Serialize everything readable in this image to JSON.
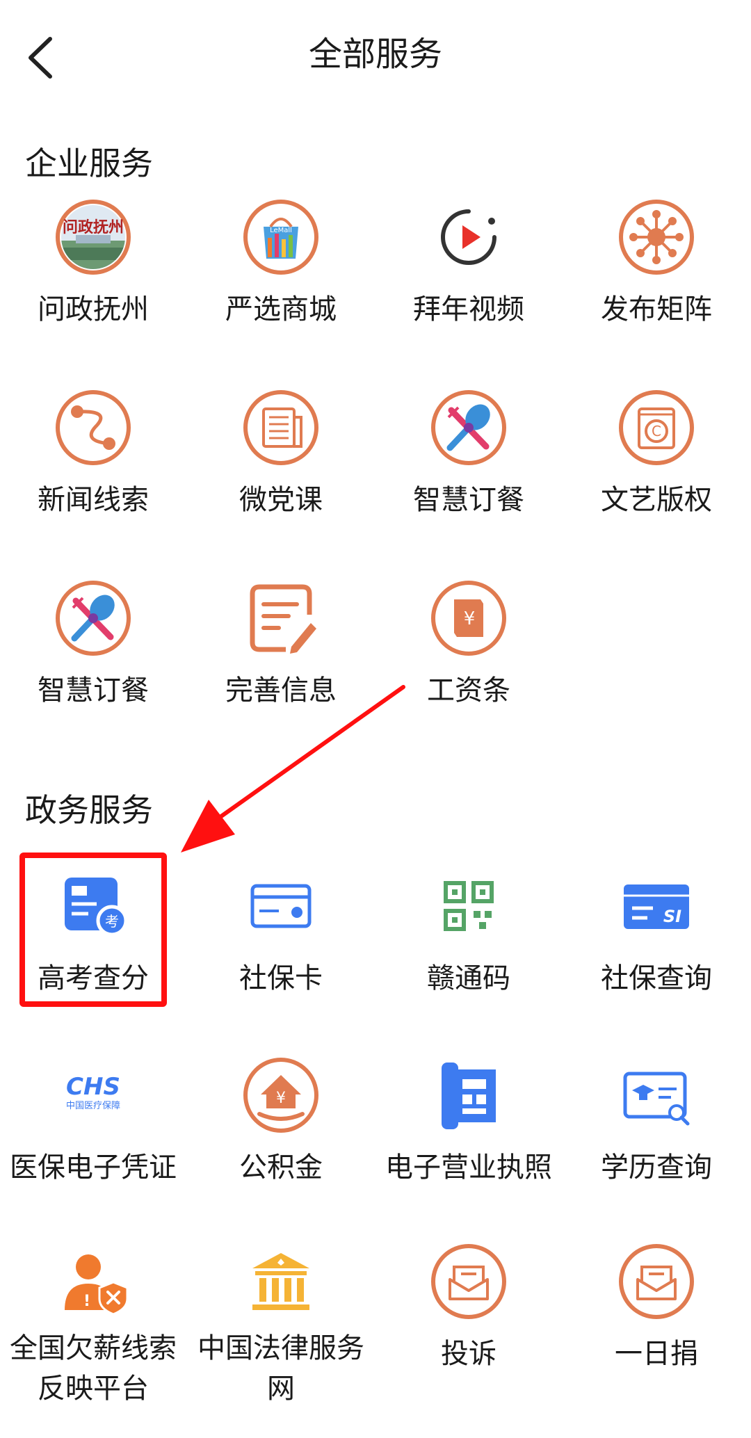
{
  "header": {
    "title": "全部服务"
  },
  "sections": [
    {
      "title": "企业服务",
      "items": [
        {
          "label": "问政抚州",
          "icon": "wenzheng-fuzhou-photo-icon"
        },
        {
          "label": "严选商城",
          "icon": "lemall-shopping-icon"
        },
        {
          "label": "拜年视频",
          "icon": "play-video-icon"
        },
        {
          "label": "发布矩阵",
          "icon": "network-hub-icon"
        },
        {
          "label": "新闻线索",
          "icon": "route-path-icon"
        },
        {
          "label": "微党课",
          "icon": "newspaper-icon"
        },
        {
          "label": "智慧订餐",
          "icon": "spoon-fork-icon"
        },
        {
          "label": "文艺版权",
          "icon": "copyright-book-icon"
        },
        {
          "label": "智慧订餐",
          "icon": "spoon-fork-icon"
        },
        {
          "label": "完善信息",
          "icon": "edit-form-icon"
        },
        {
          "label": "工资条",
          "icon": "yuan-receipt-icon"
        }
      ]
    },
    {
      "title": "政务服务",
      "items": [
        {
          "label": "高考查分",
          "icon": "exam-score-icon",
          "badge": "考"
        },
        {
          "label": "社保卡",
          "icon": "social-security-card-icon"
        },
        {
          "label": "赣通码",
          "icon": "qr-code-icon"
        },
        {
          "label": "社保查询",
          "icon": "si-card-icon",
          "badge": "SI"
        },
        {
          "label": "医保电子凭证",
          "icon": "chs-medical-insurance-icon",
          "badge": "CHS",
          "badge_sub": "中国医疗保障"
        },
        {
          "label": "公积金",
          "icon": "housing-fund-icon"
        },
        {
          "label": "电子营业执照",
          "icon": "business-license-icon"
        },
        {
          "label": "学历查询",
          "icon": "education-certificate-icon"
        },
        {
          "label": "全国欠薪线索反映平台",
          "icon": "wage-arrears-report-icon"
        },
        {
          "label": "中国法律服务网",
          "icon": "court-building-icon"
        },
        {
          "label": "投诉",
          "icon": "complaint-mail-icon"
        },
        {
          "label": "一日捐",
          "icon": "donation-mail-icon"
        }
      ]
    }
  ],
  "colors": {
    "accent": "#e07b50",
    "blue": "#3d7bf0",
    "green": "#55a466",
    "highlight": "#ff1010"
  }
}
